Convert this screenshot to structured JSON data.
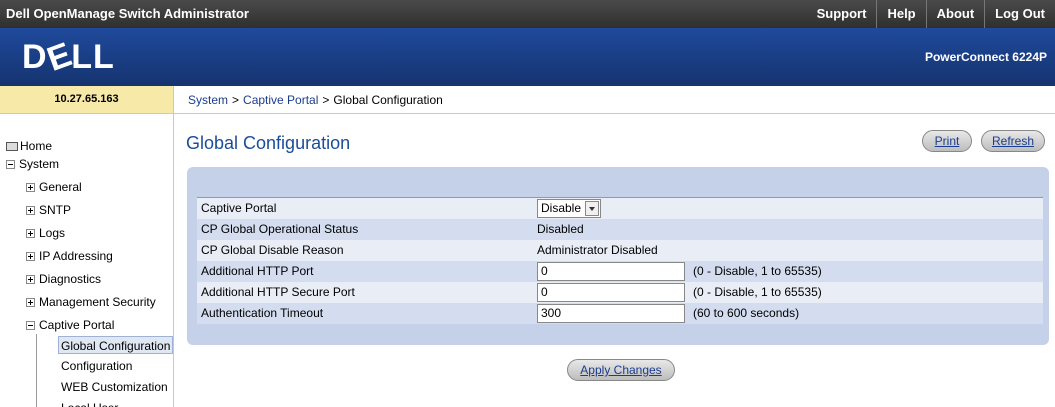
{
  "app_title": "Dell OpenManage Switch Administrator",
  "top_links": [
    "Support",
    "Help",
    "About",
    "Log Out"
  ],
  "brand": {
    "logo_text": "DELL",
    "model": "PowerConnect 6224P",
    "accent_color": "#1f4a9c"
  },
  "ip_address": "10.27.65.163",
  "breadcrumb": [
    "System",
    "Captive Portal",
    "Global Configuration"
  ],
  "nav": {
    "home": "Home",
    "system": "System",
    "items": [
      {
        "label": "General"
      },
      {
        "label": "SNTP"
      },
      {
        "label": "Logs"
      },
      {
        "label": "IP Addressing"
      },
      {
        "label": "Diagnostics"
      },
      {
        "label": "Management Security"
      },
      {
        "label": "Captive Portal"
      }
    ],
    "captive_portal_children": [
      {
        "label": "Global Configuration",
        "selected": true
      },
      {
        "label": "Configuration"
      },
      {
        "label": "WEB Customization"
      },
      {
        "label": "Local User"
      }
    ]
  },
  "page": {
    "title": "Global Configuration",
    "print_label": "Print",
    "refresh_label": "Refresh",
    "apply_label": "Apply Changes"
  },
  "form": {
    "rows": [
      {
        "label": "Captive Portal",
        "value": "Disable",
        "kind": "select"
      },
      {
        "label": "CP Global Operational Status",
        "value": "Disabled",
        "kind": "text"
      },
      {
        "label": "CP Global Disable Reason",
        "value": "Administrator Disabled",
        "kind": "text"
      },
      {
        "label": "Additional HTTP Port",
        "value": "0",
        "kind": "input",
        "hint": "(0 - Disable, 1 to 65535)"
      },
      {
        "label": "Additional HTTP Secure Port",
        "value": "0",
        "kind": "input",
        "hint": "(0 - Disable, 1 to 65535)"
      },
      {
        "label": "Authentication Timeout",
        "value": "300",
        "kind": "input",
        "hint": "(60 to 600 seconds)"
      }
    ]
  }
}
